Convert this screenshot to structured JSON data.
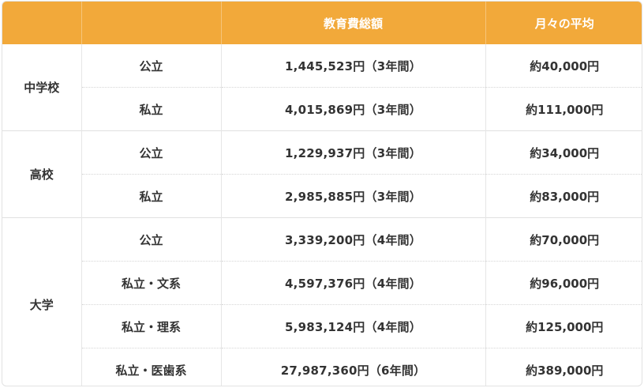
{
  "header": {
    "col1": "",
    "col2": "",
    "total": "教育費総額",
    "monthly": "月々の平均"
  },
  "groups": [
    {
      "level": "中学校",
      "rows": [
        {
          "type": "公立",
          "total": "1,445,523円（3年間）",
          "monthly": "約40,000円"
        },
        {
          "type": "私立",
          "total": "4,015,869円（3年間）",
          "monthly": "約111,000円"
        }
      ]
    },
    {
      "level": "高校",
      "rows": [
        {
          "type": "公立",
          "total": "1,229,937円（3年間）",
          "monthly": "約34,000円"
        },
        {
          "type": "私立",
          "total": "2,985,885円（3年間）",
          "monthly": "約83,000円"
        }
      ]
    },
    {
      "level": "大学",
      "rows": [
        {
          "type": "公立",
          "total": "3,339,200円（4年間）",
          "monthly": "約70,000円"
        },
        {
          "type": "私立・文系",
          "total": "4,597,376円（4年間）",
          "monthly": "約96,000円"
        },
        {
          "type": "私立・理系",
          "total": "5,983,124円（4年間）",
          "monthly": "約125,000円"
        },
        {
          "type": "私立・医歯系",
          "total": "27,987,360円（6年間）",
          "monthly": "約389,000円"
        }
      ]
    }
  ]
}
